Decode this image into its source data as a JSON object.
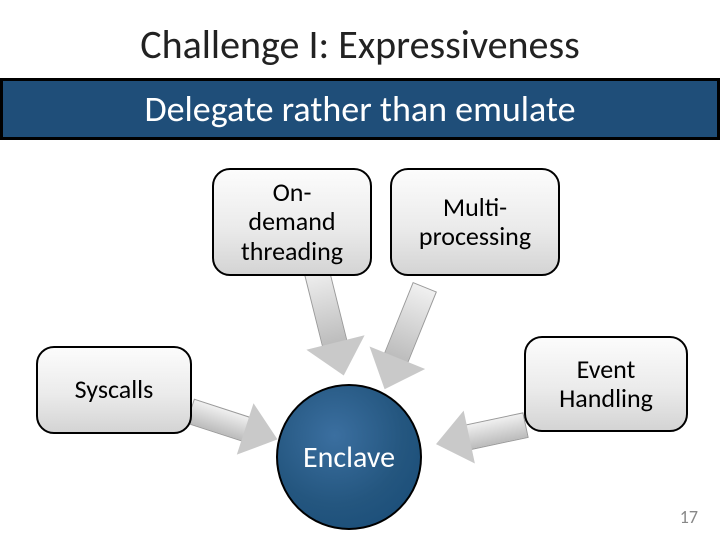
{
  "title": "Challenge I: Expressiveness",
  "banner": "Delegate rather than emulate",
  "nodes": {
    "threading": "On-\ndemand\nthreading",
    "multi": "Multi-\nprocessing",
    "syscalls": "Syscalls",
    "event": "Event\nHandling",
    "enclave": "Enclave"
  },
  "page_number": "17",
  "diagram": {
    "type": "hub-spoke",
    "center": "Enclave",
    "inbound": [
      "On-demand threading",
      "Multi-processing",
      "Syscalls",
      "Event Handling"
    ]
  }
}
